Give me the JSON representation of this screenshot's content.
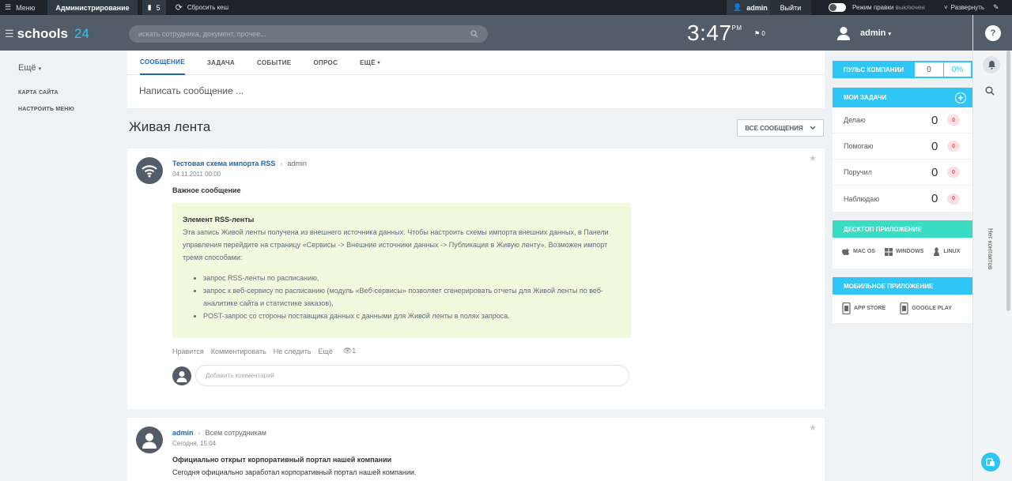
{
  "topbar": {
    "menu_label": "Меню",
    "admin_label": "Администрирование",
    "notif_count": "5",
    "reset_cache": "Сбросить кеш",
    "user": "admin",
    "exit": "Выйти",
    "edit_mode_label": "Режим правки",
    "edit_mode_state": "выключен",
    "expand": "Развернуть"
  },
  "header": {
    "logo_main": "schools",
    "logo_num": "24",
    "search_placeholder": "искать сотрудника, документ, прочее...",
    "time": "3:47",
    "ampm": "PM",
    "flag_count": "0",
    "user": "admin"
  },
  "leftmenu": {
    "more": "Ещё",
    "items": [
      "КАРТА САЙТА",
      "НАСТРОИТЬ МЕНЮ"
    ]
  },
  "poster": {
    "tabs": [
      "СООБЩЕНИЕ",
      "ЗАДАЧА",
      "СОБЫТИЕ",
      "ОПРОС",
      "ЕЩЁ"
    ],
    "write_placeholder": "Написать сообщение ..."
  },
  "feed": {
    "title": "Живая лента",
    "filter": "ВСЕ СООБЩЕНИЯ"
  },
  "post1": {
    "author": "Тестовая схема импорта RSS",
    "dest": "admin",
    "date": "04.11.2011 00:00",
    "title": "Важное сообщение",
    "rss_heading": "Элемент RSS-ленты",
    "rss_text": "Эта запись Живой ленты получена из внешнего источника данных. Чтобы настроить схемы импорта внешних данных, в Панели управления перейдите на страницу «Сервисы -> Внешние источники данных -> Публикация в Живую ленту». Возможен импорт тремя способами:",
    "rss_items": [
      "запрос RSS-ленты по расписанию,",
      "запрос к веб-сервису по расписанию (модуль «Веб-сервисы» позволяет сгенерировать отчеты для Живой ленты по веб-аналитике сайта и статистике заказов),",
      "POST-запрос со стороны поставщика данных с данными для Живой ленты в полях запроса."
    ],
    "actions": [
      "Нравится",
      "Комментировать",
      "Не следить",
      "Ещё"
    ],
    "views": "1",
    "comment_placeholder": "Добавить комментарий"
  },
  "post2": {
    "author": "admin",
    "dest": "Всем сотрудникам",
    "date": "Сегодня, 15:04",
    "title": "Официально открыт корпоративный портал нашей компании",
    "text": "Сегодня официально заработал корпоративный портал нашей компании."
  },
  "pulse": {
    "label": "ПУЛЬС КОМПАНИИ",
    "value": "0",
    "percent": "0%"
  },
  "tasks": {
    "title": "МОИ ЗАДАЧИ",
    "rows": [
      {
        "label": "Делаю",
        "count": "0",
        "badge": "0"
      },
      {
        "label": "Помогаю",
        "count": "0",
        "badge": "0"
      },
      {
        "label": "Поручил",
        "count": "0",
        "badge": "0"
      },
      {
        "label": "Наблюдаю",
        "count": "0",
        "badge": "0"
      }
    ]
  },
  "desktop": {
    "title": "ДЕСКТОП ПРИЛОЖЕНИЕ",
    "os": [
      "MAC OS",
      "WINDOWS",
      "LINUX"
    ]
  },
  "mobile": {
    "title": "МОБИЛЬНОЕ ПРИЛОЖЕНИЕ",
    "stores": [
      "APP STORE",
      "GOOGLE PLAY"
    ]
  },
  "rightstrip": {
    "no_contacts": "Нет контактов"
  },
  "colors": {
    "accent": "#2fc6f6",
    "header": "#535c69",
    "link": "#2067b0",
    "desktop": "#3bdcc4",
    "rss_bg": "#f2fadd"
  }
}
